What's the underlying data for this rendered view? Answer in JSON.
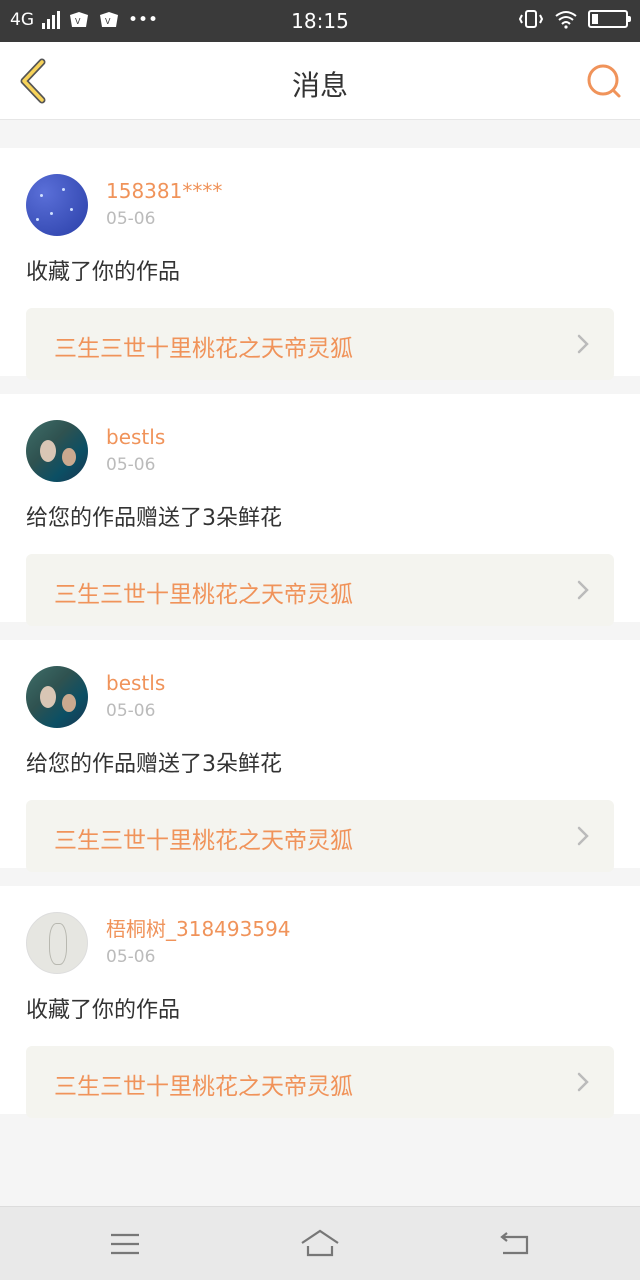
{
  "status_bar": {
    "network": "4G",
    "time": "18:15"
  },
  "header": {
    "title": "消息"
  },
  "messages": [
    {
      "username": "158381****",
      "date": "05-06",
      "action": "收藏了你的作品",
      "work_title": "三生三世十里桃花之天帝灵狐"
    },
    {
      "username": "bestls",
      "date": "05-06",
      "action": "给您的作品赠送了3朵鲜花",
      "work_title": "三生三世十里桃花之天帝灵狐"
    },
    {
      "username": "bestls",
      "date": "05-06",
      "action": "给您的作品赠送了3朵鲜花",
      "work_title": "三生三世十里桃花之天帝灵狐"
    },
    {
      "username": "梧桐树_318493594",
      "date": "05-06",
      "action": "收藏了你的作品",
      "work_title": "三生三世十里桃花之天帝灵狐"
    }
  ],
  "colors": {
    "accent": "#f0935a",
    "status_bar": "#3a3a3a",
    "work_bg": "#f4f4ef"
  },
  "icons": {
    "header": [
      "chevron-left-icon",
      "search-icon"
    ],
    "status": [
      "signal-icon",
      "vibrate-icon",
      "wifi-icon",
      "battery-icon"
    ],
    "nav": [
      "menu-icon",
      "home-icon",
      "back-icon"
    ]
  }
}
